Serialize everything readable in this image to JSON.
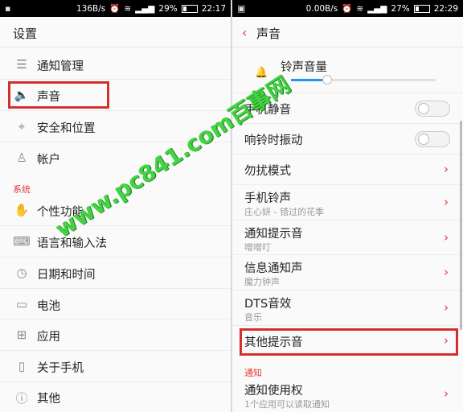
{
  "left": {
    "status": {
      "speed": "136B/s",
      "battery_text": "29%",
      "battery_level": 0.29,
      "time": "22:17"
    },
    "title": "设置",
    "items_top": [
      {
        "icon": "notification-icon",
        "label": "通知管理"
      },
      {
        "icon": "speaker-icon",
        "label": "声音"
      },
      {
        "icon": "location-icon",
        "label": "安全和位置"
      },
      {
        "icon": "person-icon",
        "label": "帐户"
      }
    ],
    "section_label": "系统",
    "items_system": [
      {
        "icon": "hand-icon",
        "label": "个性功能"
      },
      {
        "icon": "keyboard-icon",
        "label": "语言和输入法"
      },
      {
        "icon": "clock-icon",
        "label": "日期和时间"
      },
      {
        "icon": "battery-icon",
        "label": "电池"
      },
      {
        "icon": "apps-icon",
        "label": "应用"
      },
      {
        "icon": "phone-icon",
        "label": "关于手机"
      },
      {
        "icon": "info-icon",
        "label": "其他"
      }
    ]
  },
  "right": {
    "status": {
      "speed": "0.00B/s",
      "battery_text": "27%",
      "battery_level": 0.27,
      "time": "22:29"
    },
    "title": "声音",
    "ringtone_volume": {
      "label": "铃声音量",
      "level": 0.25
    },
    "toggles": [
      {
        "label": "手机静音",
        "on": false
      },
      {
        "label": "响铃时振动",
        "on": false
      }
    ],
    "items": [
      {
        "label": "勿扰模式",
        "sub": ""
      },
      {
        "label": "手机铃声",
        "sub": "庄心妍 - 错过的花季"
      },
      {
        "label": "通知提示音",
        "sub": "噌噌叮"
      },
      {
        "label": "信息通知声",
        "sub": "魔力钟声"
      },
      {
        "label": "DTS音效",
        "sub": "音乐"
      },
      {
        "label": "其他提示音",
        "sub": ""
      }
    ],
    "section_label": "通知",
    "notify_access": {
      "label": "通知使用权",
      "sub": "1个应用可以读取通知"
    }
  },
  "watermark": "www.pc841.com百事网",
  "colors": {
    "accent": "#e53935",
    "highlight": "#d32f2f",
    "slider": "#2196f3",
    "watermark": "#3ad13a"
  }
}
